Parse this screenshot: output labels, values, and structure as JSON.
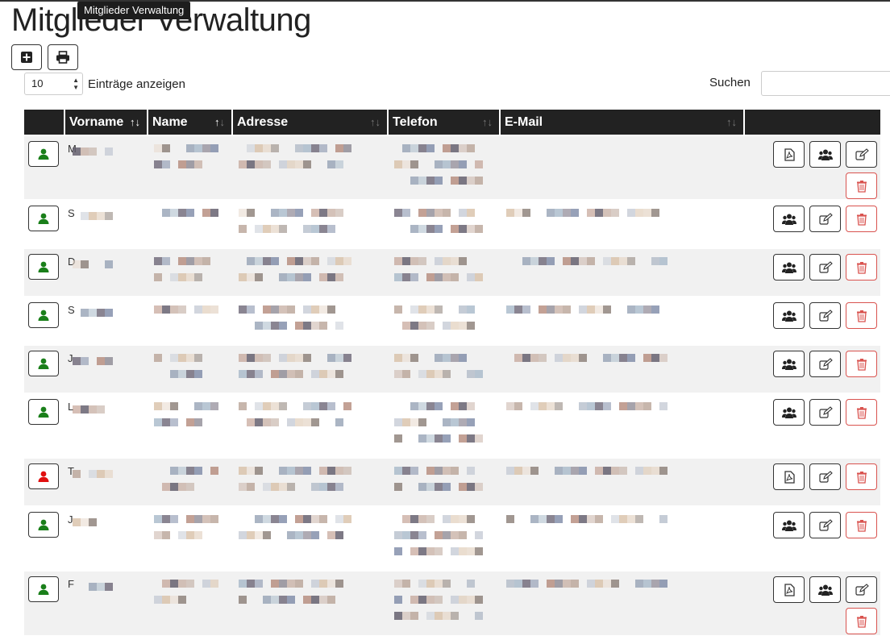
{
  "page": {
    "title": "Mitglieder Verwaltung",
    "tooltip": "Mitglieder Verwaltung"
  },
  "toolbar": {
    "add_icon": "plus-square-icon",
    "print_icon": "print-icon"
  },
  "table_controls": {
    "length_value": "10",
    "length_label": "Einträge anzeigen",
    "search_label": "Suchen",
    "search_value": ""
  },
  "columns": [
    "",
    "Vorname",
    "Name",
    "Adresse",
    "Telefon",
    "E-Mail",
    ""
  ],
  "rows": [
    {
      "status": "green",
      "initial": "M",
      "buttons": [
        "pdf",
        "group",
        "edit",
        "delete"
      ]
    },
    {
      "status": "green",
      "initial": "S",
      "buttons": [
        "group",
        "edit",
        "delete"
      ]
    },
    {
      "status": "green",
      "initial": "D",
      "buttons": [
        "group",
        "edit",
        "delete"
      ]
    },
    {
      "status": "green",
      "initial": "S",
      "buttons": [
        "group",
        "edit",
        "delete"
      ]
    },
    {
      "status": "green",
      "initial": "J",
      "buttons": [
        "group",
        "edit",
        "delete"
      ]
    },
    {
      "status": "green",
      "initial": "L",
      "buttons": [
        "group",
        "edit",
        "delete"
      ]
    },
    {
      "status": "red",
      "initial": "T",
      "buttons": [
        "pdf",
        "edit",
        "delete"
      ]
    },
    {
      "status": "green",
      "initial": "J",
      "buttons": [
        "group",
        "edit",
        "delete"
      ]
    },
    {
      "status": "green",
      "initial": "F",
      "buttons": [
        "pdf",
        "group",
        "edit",
        "delete"
      ]
    }
  ],
  "colors": {
    "header_bg": "#222222",
    "status_green": "#1a7f1a",
    "status_red": "#e01010",
    "delete_red": "#d9534f",
    "row_stripe": "#f1f1f1"
  }
}
